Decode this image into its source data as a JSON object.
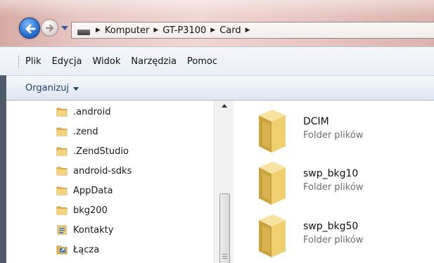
{
  "breadcrumb": [
    {
      "label": "Komputer"
    },
    {
      "label": "GT-P3100"
    },
    {
      "label": "Card"
    }
  ],
  "menu": [
    "Plik",
    "Edycja",
    "Widok",
    "Narzędzia",
    "Pomoc"
  ],
  "toolbar": {
    "organize_label": "Organizuj"
  },
  "nav_tree": [
    {
      "label": ".android",
      "icon": "folder-icon"
    },
    {
      "label": ".zend",
      "icon": "folder-icon"
    },
    {
      "label": ".ZendStudio",
      "icon": "folder-icon"
    },
    {
      "label": "android-sdks",
      "icon": "folder-icon"
    },
    {
      "label": "AppData",
      "icon": "folder-icon"
    },
    {
      "label": "bkg200",
      "icon": "folder-icon"
    },
    {
      "label": "Kontakty",
      "icon": "contacts-icon"
    },
    {
      "label": "Łącza",
      "icon": "links-icon"
    }
  ],
  "content_items": [
    {
      "name": "DCIM",
      "type": "Folder plików"
    },
    {
      "name": "swp_bkg10",
      "type": "Folder plików"
    },
    {
      "name": "swp_bkg50",
      "type": "Folder plików"
    }
  ],
  "colors": {
    "accent": "#2b76d8",
    "folder": "#e9c25a"
  }
}
